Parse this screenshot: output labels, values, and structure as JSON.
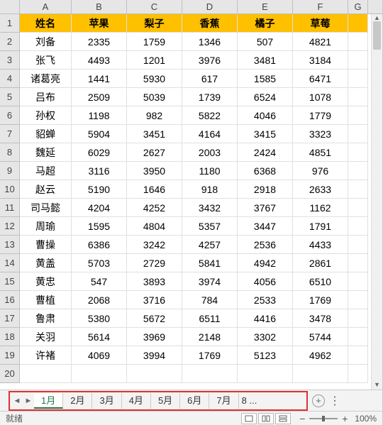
{
  "columns": [
    "A",
    "B",
    "C",
    "D",
    "E",
    "F",
    "G"
  ],
  "headers": [
    "姓名",
    "苹果",
    "梨子",
    "香蕉",
    "橘子",
    "草莓"
  ],
  "rows": [
    {
      "name": "刘备",
      "vals": [
        2335,
        1759,
        1346,
        507,
        4821
      ]
    },
    {
      "name": "张飞",
      "vals": [
        4493,
        1201,
        3976,
        3481,
        3184
      ]
    },
    {
      "name": "诸葛亮",
      "vals": [
        1441,
        5930,
        617,
        1585,
        6471
      ]
    },
    {
      "name": "吕布",
      "vals": [
        2509,
        5039,
        1739,
        6524,
        1078
      ]
    },
    {
      "name": "孙权",
      "vals": [
        1198,
        982,
        5822,
        4046,
        1779
      ]
    },
    {
      "name": "貂蝉",
      "vals": [
        5904,
        3451,
        4164,
        3415,
        3323
      ]
    },
    {
      "name": "魏延",
      "vals": [
        6029,
        2627,
        2003,
        2424,
        4851
      ]
    },
    {
      "name": "马超",
      "vals": [
        3116,
        3950,
        1180,
        6368,
        976
      ]
    },
    {
      "name": "赵云",
      "vals": [
        5190,
        1646,
        918,
        2918,
        2633
      ]
    },
    {
      "name": "司马懿",
      "vals": [
        4204,
        4252,
        3432,
        3767,
        1162
      ]
    },
    {
      "name": "周瑜",
      "vals": [
        1595,
        4804,
        5357,
        3447,
        1791
      ]
    },
    {
      "name": "曹操",
      "vals": [
        6386,
        3242,
        4257,
        2536,
        4433
      ]
    },
    {
      "name": "黄盖",
      "vals": [
        5703,
        2729,
        5841,
        4942,
        2861
      ]
    },
    {
      "name": "黄忠",
      "vals": [
        547,
        3893,
        3974,
        4056,
        6510
      ]
    },
    {
      "name": "曹植",
      "vals": [
        2068,
        3716,
        784,
        2533,
        1769
      ]
    },
    {
      "name": "鲁肃",
      "vals": [
        5380,
        5672,
        6511,
        4416,
        3478
      ]
    },
    {
      "name": "关羽",
      "vals": [
        5614,
        3969,
        2148,
        3302,
        5744
      ]
    },
    {
      "name": "许褚",
      "vals": [
        4069,
        3994,
        1769,
        5123,
        4962
      ]
    }
  ],
  "tabs": [
    "1月",
    "2月",
    "3月",
    "4月",
    "5月",
    "6月",
    "7月"
  ],
  "tab_overflow": "8 ...",
  "active_tab": 0,
  "status": {
    "ready": "就绪",
    "zoom": "100%"
  },
  "nav": {
    "left": "◄",
    "right": "►"
  },
  "chart_data": {
    "type": "table",
    "title": "",
    "columns": [
      "姓名",
      "苹果",
      "梨子",
      "香蕉",
      "橘子",
      "草莓"
    ],
    "data": [
      [
        "刘备",
        2335,
        1759,
        1346,
        507,
        4821
      ],
      [
        "张飞",
        4493,
        1201,
        3976,
        3481,
        3184
      ],
      [
        "诸葛亮",
        1441,
        5930,
        617,
        1585,
        6471
      ],
      [
        "吕布",
        2509,
        5039,
        1739,
        6524,
        1078
      ],
      [
        "孙权",
        1198,
        982,
        5822,
        4046,
        1779
      ],
      [
        "貂蝉",
        5904,
        3451,
        4164,
        3415,
        3323
      ],
      [
        "魏延",
        6029,
        2627,
        2003,
        2424,
        4851
      ],
      [
        "马超",
        3116,
        3950,
        1180,
        6368,
        976
      ],
      [
        "赵云",
        5190,
        1646,
        918,
        2918,
        2633
      ],
      [
        "司马懿",
        4204,
        4252,
        3432,
        3767,
        1162
      ],
      [
        "周瑜",
        1595,
        4804,
        5357,
        3447,
        1791
      ],
      [
        "曹操",
        6386,
        3242,
        4257,
        2536,
        4433
      ],
      [
        "黄盖",
        5703,
        2729,
        5841,
        4942,
        2861
      ],
      [
        "黄忠",
        547,
        3893,
        3974,
        4056,
        6510
      ],
      [
        "曹植",
        2068,
        3716,
        784,
        2533,
        1769
      ],
      [
        "鲁肃",
        5380,
        5672,
        6511,
        4416,
        3478
      ],
      [
        "关羽",
        5614,
        3969,
        2148,
        3302,
        5744
      ],
      [
        "许褚",
        4069,
        3994,
        1769,
        5123,
        4962
      ]
    ]
  }
}
